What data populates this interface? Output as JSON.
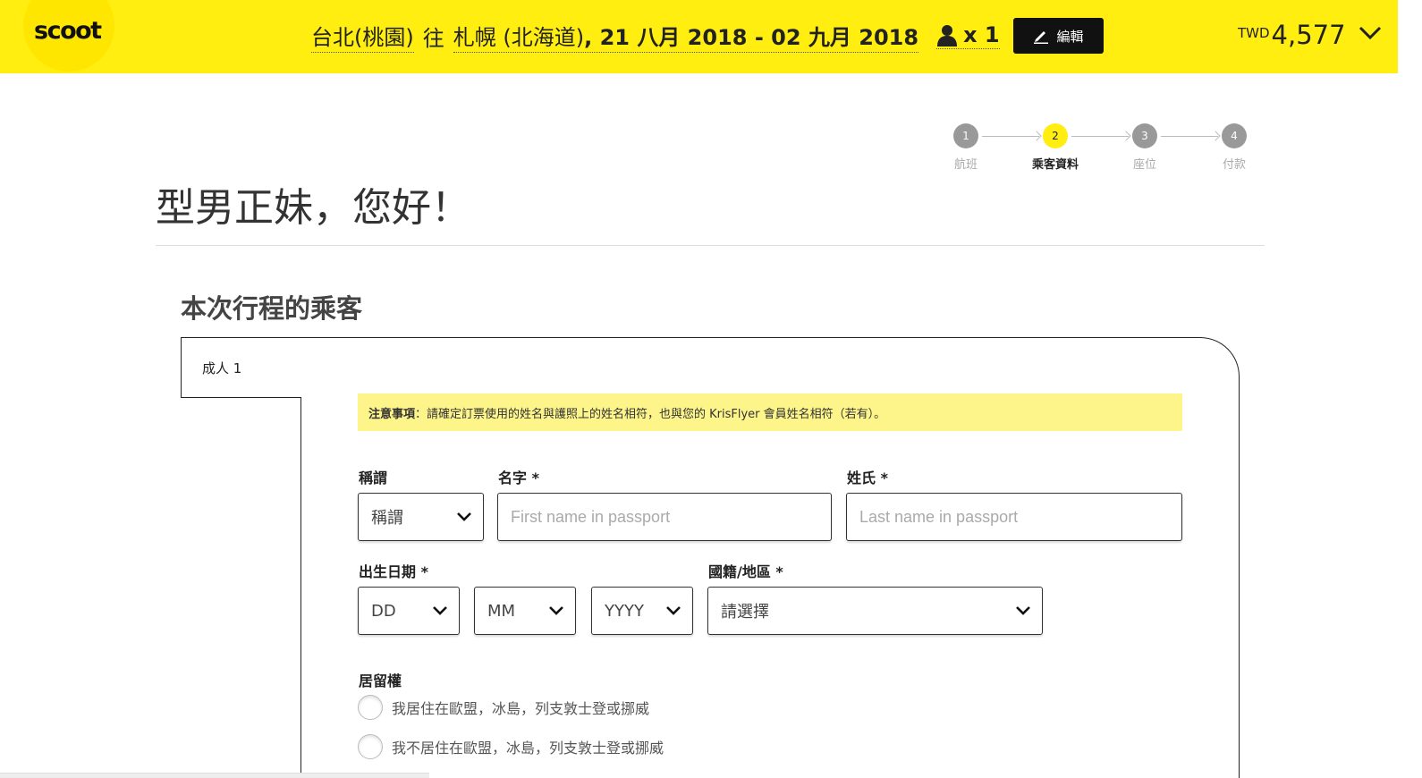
{
  "header": {
    "logo": "scoot",
    "origin": "台北(桃園)",
    "to_word": "往",
    "destination": "札幌 (北海道)",
    "dates": ", 21 八月 2018 - 02 九月 2018",
    "pax": "x 1",
    "edit_label": "編輯",
    "currency": "TWD",
    "price": "4,577"
  },
  "stepper": {
    "steps": [
      {
        "num": "1",
        "label": "航班",
        "active": false
      },
      {
        "num": "2",
        "label": "乘客資料",
        "active": true
      },
      {
        "num": "3",
        "label": "座位",
        "active": false
      },
      {
        "num": "4",
        "label": "付款",
        "active": false
      }
    ]
  },
  "greeting": "型男正妹，您好！",
  "section_title": "本次行程的乘客",
  "passenger": {
    "tab_label": "成人 1",
    "notice_strong": "注意事項",
    "notice_text": "：請確定訂票使用的姓名與護照上的姓名相符，也與您的 KrisFlyer 會員姓名相符（若有）。",
    "title_label": "稱謂",
    "title_value": "稱謂",
    "firstname_label": "名字 *",
    "firstname_placeholder": "First name in passport",
    "lastname_label": "姓氏 *",
    "lastname_placeholder": "Last name in passport",
    "dob_label": "出生日期 *",
    "dob_dd": "DD",
    "dob_mm": "MM",
    "dob_yyyy": "YYYY",
    "nationality_label": "國籍/地區 *",
    "nationality_value": "請選擇",
    "residency_label": "居留權",
    "residency_yes": "我居住在歐盟，冰島，列支敦士登或挪威",
    "residency_no": "我不居住在歐盟，冰島，列支敦士登或挪威"
  },
  "colors": {
    "brand_yellow": "#ffee10",
    "notice_yellow": "#fdf58a",
    "dark": "#111111"
  }
}
